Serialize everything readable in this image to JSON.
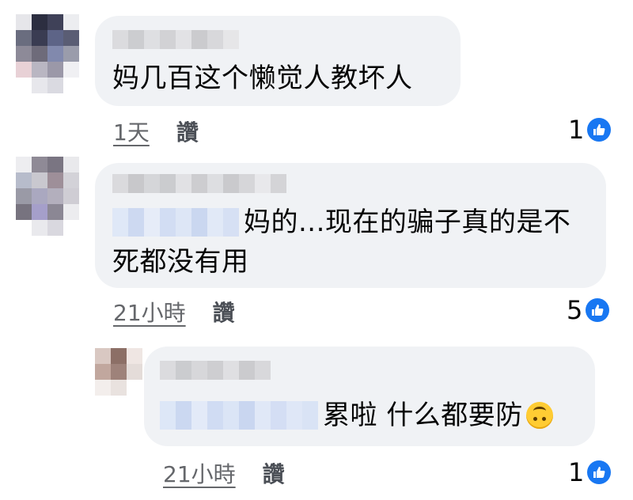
{
  "comments": [
    {
      "text_lines": [
        "妈几百这个懒觉人教坏人"
      ],
      "time": "1天",
      "like_label": "讚",
      "reaction_count": "1",
      "reaction_icon": "thumbs-up-icon"
    },
    {
      "text_lines": [
        "妈的...现在的骗子真的是不",
        "死都没有用"
      ],
      "time": "21小時",
      "like_label": "讚",
      "reaction_count": "5",
      "reaction_icon": "thumbs-up-icon"
    },
    {
      "text_lines": [
        "累啦 什么都要防"
      ],
      "emoji": "upside-down-face-icon",
      "time": "21小時",
      "like_label": "讚",
      "reaction_count": "1",
      "reaction_icon": "thumbs-up-icon"
    }
  ],
  "colors": {
    "bubble": "#f0f2f5",
    "meta_text": "#65676b",
    "reaction_blue": "#1877f2",
    "mention_blur": "#dbe6f7"
  }
}
